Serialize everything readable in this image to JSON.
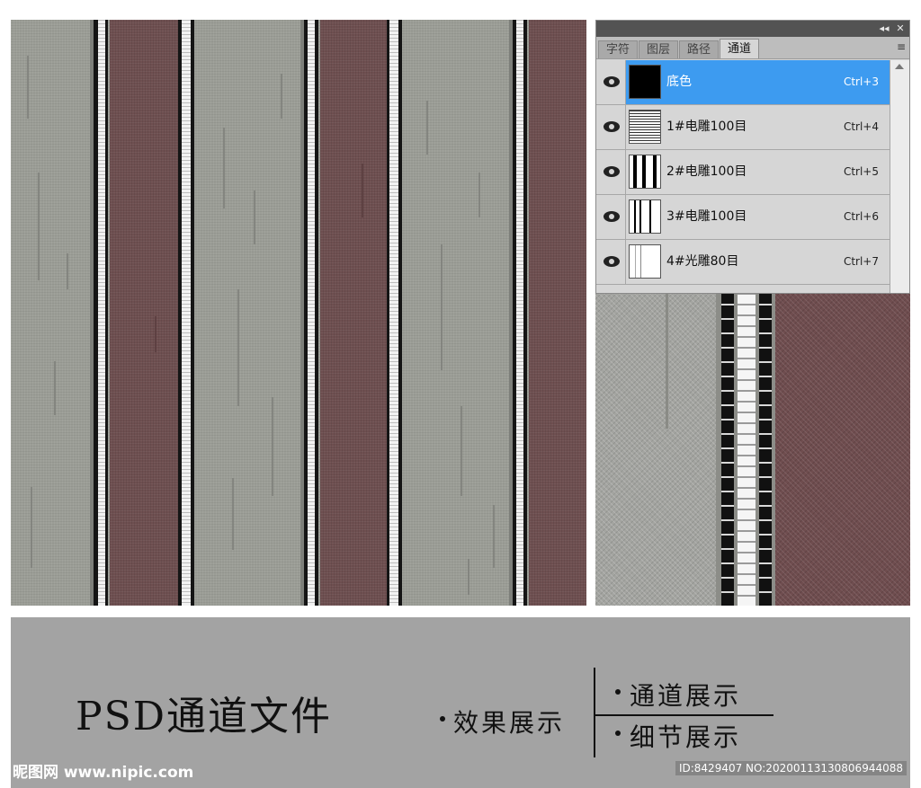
{
  "panel": {
    "tabs": [
      {
        "label": "字符",
        "active": false
      },
      {
        "label": "图层",
        "active": false
      },
      {
        "label": "路径",
        "active": false
      },
      {
        "label": "通道",
        "active": true
      }
    ],
    "topbar": {
      "collapse": "◂◂",
      "close": "✕"
    },
    "menu_icon": "≡",
    "channels": [
      {
        "name": "底色",
        "shortcut": "Ctrl+3",
        "selected": true,
        "visible": true
      },
      {
        "name": "1#电雕100目",
        "shortcut": "Ctrl+4",
        "selected": false,
        "visible": true
      },
      {
        "name": "2#电雕100目",
        "shortcut": "Ctrl+5",
        "selected": false,
        "visible": true
      },
      {
        "name": "3#电雕100目",
        "shortcut": "Ctrl+6",
        "selected": false,
        "visible": true
      },
      {
        "name": "4#光雕80目",
        "shortcut": "Ctrl+7",
        "selected": false,
        "visible": true
      }
    ]
  },
  "caption": {
    "title": "PSD通道文件",
    "effect": "效果展示",
    "channel_show": "通道展示",
    "detail_show": "细节展示"
  },
  "watermark": {
    "logo": "昵图网 www.nipic.com",
    "id": "ID:8429407 NO:20200113130806944088"
  },
  "colors": {
    "fabric_gray": "#9b9d96",
    "fabric_maroon": "#6e4f50",
    "selection_blue": "#3d9bf0",
    "caption_bg": "#a3a3a3"
  }
}
